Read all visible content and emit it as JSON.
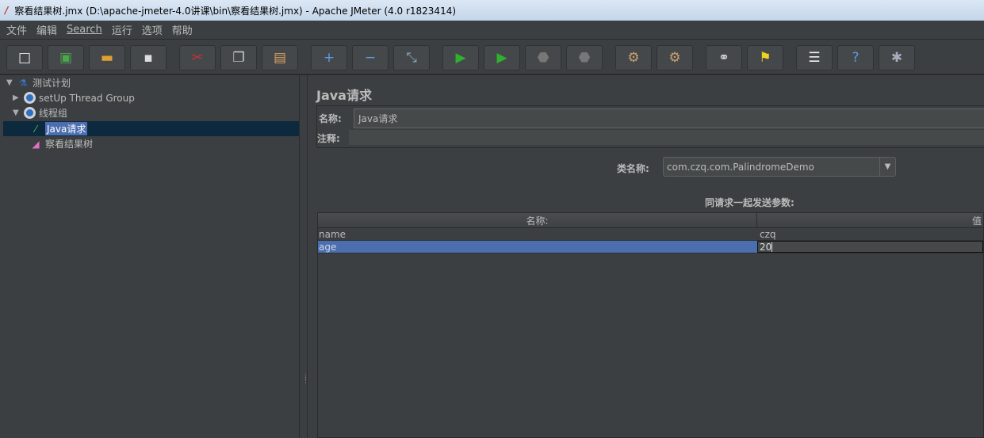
{
  "window": {
    "title": "察看结果树.jmx (D:\\apache-jmeter-4.0讲课\\bin\\察看结果树.jmx) - Apache JMeter (4.0 r1823414)"
  },
  "menu": [
    "文件",
    "编辑",
    "Search",
    "运行",
    "选项",
    "帮助"
  ],
  "toolbar": [
    {
      "name": "new",
      "icon": "□",
      "color": "#f0f0f0"
    },
    {
      "name": "templates",
      "icon": "▣",
      "color": "#4aa84a"
    },
    {
      "name": "open",
      "icon": "▬",
      "color": "#e0a030"
    },
    {
      "name": "save",
      "icon": "▪",
      "color": "#ddd"
    },
    {
      "name": "cut",
      "icon": "✂",
      "color": "#d03030"
    },
    {
      "name": "copy",
      "icon": "❐",
      "color": "#ccc"
    },
    {
      "name": "paste",
      "icon": "▤",
      "color": "#d8a060"
    },
    {
      "name": "expand",
      "icon": "+",
      "color": "#5a9be0"
    },
    {
      "name": "collapse",
      "icon": "−",
      "color": "#5a9be0"
    },
    {
      "name": "toggle",
      "icon": "⤡",
      "color": "#8ab"
    },
    {
      "name": "start",
      "icon": "▶",
      "color": "#2fb02f"
    },
    {
      "name": "start-no-pause",
      "icon": "▶",
      "color": "#2fb02f"
    },
    {
      "name": "stop",
      "icon": "⬣",
      "color": "#777"
    },
    {
      "name": "shutdown",
      "icon": "⬣",
      "color": "#777"
    },
    {
      "name": "clear",
      "icon": "⚙",
      "color": "#c8a070"
    },
    {
      "name": "clear-all",
      "icon": "⚙",
      "color": "#c8a070"
    },
    {
      "name": "search",
      "icon": "⚭",
      "color": "#ddd"
    },
    {
      "name": "reset-search",
      "icon": "⚑",
      "color": "#f0d020"
    },
    {
      "name": "function-helper",
      "icon": "☰",
      "color": "#eee"
    },
    {
      "name": "help",
      "icon": "?",
      "color": "#5a9be0"
    },
    {
      "name": "remote",
      "icon": "✱",
      "color": "#aab"
    }
  ],
  "tree": [
    {
      "label": "测试计划",
      "icon": "flask-icon",
      "expanded": true
    },
    {
      "label": "setUp Thread Group",
      "icon": "gear-icon",
      "expanded": false
    },
    {
      "label": "线程组",
      "icon": "gear-icon",
      "expanded": true
    },
    {
      "label": "Java请求",
      "icon": "pipette-icon",
      "selected": true
    },
    {
      "label": "察看结果树",
      "icon": "chart-icon"
    }
  ],
  "panel": {
    "title": "Java请求",
    "name_label": "名称:",
    "name_value": "Java请求",
    "comment_label": "注释:",
    "comment_value": "",
    "classname_label": "类名称:",
    "classname_value": "com.czq.com.PalindromeDemo",
    "params_label": "同请求一起发送参数:",
    "columns": [
      "名称:",
      "值"
    ],
    "rows": [
      [
        "name",
        "czq"
      ],
      [
        "age",
        "20"
      ]
    ]
  },
  "colors": {
    "background": "#3c3f41",
    "selection": "#4b6eaf",
    "tree_selection": "#0d293e"
  }
}
